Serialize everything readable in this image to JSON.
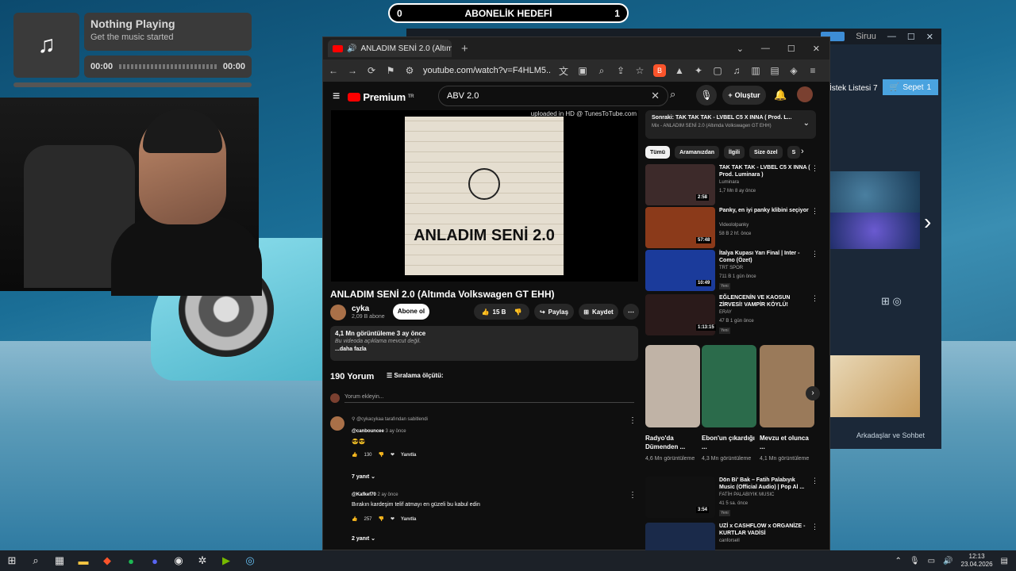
{
  "overlay": {
    "goal_left": "0",
    "goal_title": "ABONELİK HEDEFİ",
    "goal_right": "1",
    "music_title": "Nothing Playing",
    "music_sub": "Get the music started",
    "music_time_left": "00:00",
    "music_time_right": "00:00"
  },
  "steam": {
    "user": "Siruu",
    "wishlist": "İstek Listesi",
    "wishlist_count": "7",
    "cart": "Sepet",
    "cart_count": "1",
    "friends": "Arkadaşlar ve Sohbet"
  },
  "browser": {
    "tab_title": "ANLADIM SENİ 2.0 (Altımda Volkswagen GT EHH)",
    "url": "youtube.com/watch?v=F4HLM5..."
  },
  "youtube": {
    "logo": "Premium",
    "logo_region": "TR",
    "search_value": "ABV 2.0",
    "create": "Oluştur",
    "video_note": "uploaded in HD @ TunesToTube.com",
    "cover_title": "ANLADIM SENİ 2.0",
    "video_title": "ANLADIM SENİ 2.0 (Altımda Volkswagen GT EHH)",
    "channel": "cyka",
    "subs": "2,09 B abone",
    "subscribe": "Abone ol",
    "likes": "15 B",
    "share": "Paylaş",
    "save": "Kaydet",
    "desc_stats": "4,1 Mn görüntüleme  3 ay önce",
    "desc_text": "Bu videoda açıklama mevcut değil.",
    "desc_more": "...daha fazla",
    "comment_count": "190 Yorum",
    "sort": "Sıralama ölçütü:",
    "add_comment": "Yorum ekleyin...",
    "comments": [
      {
        "pin": "@cykacykaa tarafından sabitlendi",
        "user": "@canbouncee",
        "time": "3 ay önce",
        "text": "😎😎",
        "likes": "130",
        "reply": "Yanıtla",
        "replies": "7 yanıt"
      },
      {
        "pin": "",
        "user": "@Kafkef70",
        "time": "2 ay önce",
        "text": "Bırakın kardeşim telif atmayı en güzeli bu kabul edin",
        "likes": "257",
        "reply": "Yanıtla",
        "replies": "2 yanıt"
      }
    ],
    "next_label": "Sonraki:",
    "next_title": "TAK TAK TAK - LVBEL C5 X INNA ( Prod. L...",
    "next_sub": "Mix - ANLADIM SENİ 2.0 (Altımda Volkswagen GT EHH)",
    "chips": [
      "Tümü",
      "Aramanızdan",
      "İlgili",
      "Size özel",
      "S"
    ],
    "recs": [
      {
        "title": "TAK TAK TAK - LVBEL C5 X INNA ( Prod. Luminara )",
        "channel": "Luminara",
        "meta": "1,7 Mn  8 ay önce",
        "duration": "2:58",
        "color": "#3d2a2a",
        "new": ""
      },
      {
        "title": "Panky, en iyi panky klibini seçiyor",
        "channel": "Videololpanky",
        "meta": "58 B  2 hf. önce",
        "duration": "57:48",
        "color": "#8b3a1a",
        "new": ""
      },
      {
        "title": "İtalya Kupası Yarı Final | Inter - Como (Özet)",
        "channel": "TRT SPOR",
        "meta": "711 B  1 gün önce",
        "duration": "10:49",
        "color": "#1b3b9b",
        "new": "Yeni"
      },
      {
        "title": "EĞLENCENİN VE KAOSUN ZİRVESİ! VAMPİR KÖYLÜ!",
        "channel": "ERAY",
        "meta": "47 B  1 gün önce",
        "duration": "1:13:15",
        "color": "#2a1a1a",
        "new": "Yeni"
      }
    ],
    "shorts": [
      {
        "title": "Radyo'da Dümenden ...",
        "views": "4,6 Mn görüntüleme",
        "color": "#c0b3a6"
      },
      {
        "title": "Ebon'un çıkardığı ...",
        "views": "4,3 Mn görüntüleme",
        "color": "#2b6b4b"
      },
      {
        "title": "Mevzu et olunca ...",
        "views": "4,1 Mn görüntüleme",
        "color": "#9a7a5a"
      }
    ],
    "recs2": [
      {
        "title": "Dön Bi' Bak – Fatih Palabıyık Music (Official Audio) | Pop Al ...",
        "channel": "FATİH PALABIYIK MUSIC",
        "meta": "41  5 sa. önce",
        "duration": "3:54",
        "color": "#111",
        "new": "Yeni"
      },
      {
        "title": "UZİ x CASHFLOW x ORGANİZE - KURTLAR VADİSİ",
        "channel": "canforsell",
        "meta": "",
        "duration": "",
        "color": "#1a2a4a",
        "new": ""
      }
    ]
  },
  "taskbar": {
    "time": "12:13",
    "date": "23.04.2026"
  }
}
